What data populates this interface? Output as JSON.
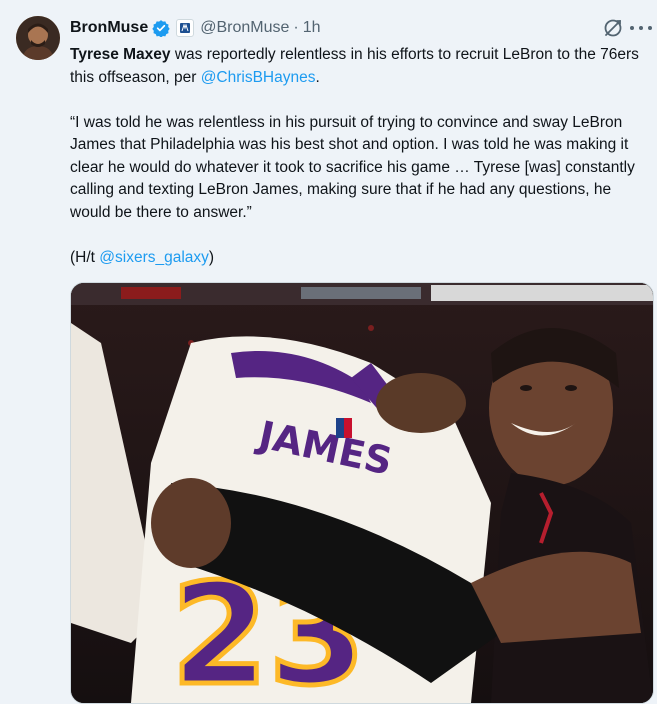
{
  "author": {
    "display_name": "BronMuse",
    "handle": "@BronMuse",
    "separator": "·",
    "timestamp": "1h",
    "verified": true,
    "avatar_icon": "avatar-photo",
    "accent_color": "#1d9bf0"
  },
  "tweet": {
    "line1_bold": "Tyrese Maxey",
    "line1_rest": " was reportedly relentless in his efforts to recruit LeBron to the 76ers this offseason, per ",
    "line1_link": "@ChrisBHaynes",
    "line1_end": ".",
    "quote": "“I was told he was relentless in his pursuit of trying to convince and sway LeBron James that Philadelphia was his best shot and option. I was told he was making it clear he would do whatever it took to sacrifice his game … Tyrese [was] constantly calling and texting LeBron James, making sure that if he had any questions, he would be there to answer.”",
    "ht_prefix": "(H/t ",
    "ht_link": "@sixers_galaxy",
    "ht_suffix": ")"
  },
  "media": {
    "jersey_name": "JAMES",
    "jersey_number": "23",
    "description_icon": "photo-embrace"
  }
}
